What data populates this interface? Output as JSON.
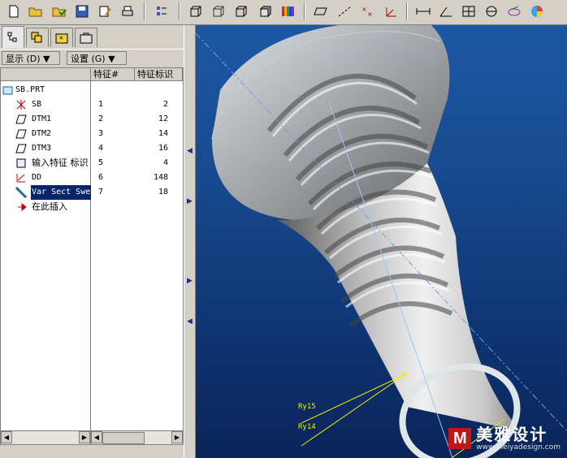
{
  "toolbar": {
    "icons": [
      "new-file-icon",
      "open-folder-icon",
      "open-recent-icon",
      "save-icon",
      "edit-icon",
      "print-icon",
      "regenerate-icon",
      "wireframe-icon",
      "hidden-line-icon",
      "no-hidden-icon",
      "shaded-icon",
      "color-icon",
      "datum-plane-icon",
      "datum-axis-icon",
      "datum-point-icon",
      "coordinate-system-icon",
      "measure-distance-icon",
      "measure-angle-icon",
      "measure-area-icon",
      "section-icon",
      "model-analysis-icon",
      "color-analysis-icon"
    ]
  },
  "panel": {
    "tabs": [
      "model-tree-tab",
      "layers-tab",
      "favorites-tab",
      "tools-tab"
    ],
    "show_menu": "显示 (D) ▼",
    "settings_menu": "设置 (G) ▼",
    "columns": {
      "feature_no": "特征#",
      "feature_id": "特征标识"
    }
  },
  "tree": {
    "root": "SB.PRT",
    "items": [
      {
        "label": "SB",
        "no": "1",
        "id": "2"
      },
      {
        "label": "DTM1",
        "no": "2",
        "id": "12"
      },
      {
        "label": "DTM2",
        "no": "3",
        "id": "14"
      },
      {
        "label": "DTM3",
        "no": "4",
        "id": "16"
      },
      {
        "label": "输入特征 标识",
        "no": "5",
        "id": "4"
      },
      {
        "label": "DD",
        "no": "6",
        "id": "148"
      },
      {
        "label": "Var Sect Swe",
        "no": "7",
        "id": "18"
      },
      {
        "label": "在此插入",
        "no": "",
        "id": ""
      }
    ]
  },
  "viewport": {
    "annotations": [
      "Ry15",
      "Ry14"
    ],
    "watermark_cn": "美雅设计",
    "watermark_url": "www.meiyadesign.com"
  }
}
